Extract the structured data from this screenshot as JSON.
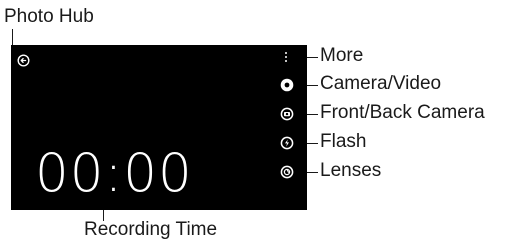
{
  "colors": {
    "screen_background": "#000000",
    "icon_color": "#ffffff",
    "callout_color": "#1a1a1a"
  },
  "annotations": {
    "photo_hub": "Photo Hub",
    "recording_time": "Recording Time",
    "more": "More",
    "camera_video": "Camera/Video",
    "front_back_camera": "Front/Back Camera",
    "flash": "Flash",
    "lenses": "Lenses"
  },
  "viewfinder": {
    "timer": "00:00",
    "icons": {
      "photo_hub": "photo-hub-icon",
      "more": "more-icon",
      "camera_video": "camera-video-icon",
      "front_back_camera": "switch-camera-icon",
      "flash": "flash-icon",
      "lenses": "lenses-icon"
    }
  }
}
